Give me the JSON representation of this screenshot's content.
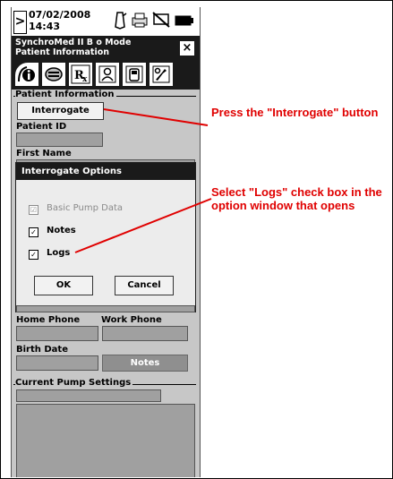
{
  "status_bar": {
    "date": "07/02/2008",
    "time": "14:43",
    "chevron": ">"
  },
  "title_bar": {
    "line1": "SynchroMed II B o Mode",
    "line2": "Patient Information",
    "close": "×"
  },
  "tabs": [
    "info-icon",
    "pump-icon",
    "rx-icon",
    "patient-icon",
    "phone-icon",
    "tools-icon"
  ],
  "patient_info": {
    "group_label": "Patient Information",
    "interrogate_label": "Interrogate",
    "patient_id_label": "Patient ID",
    "first_name_label": "First Name",
    "home_phone_label": "Home Phone",
    "work_phone_label": "Work Phone",
    "birth_date_label": "Birth Date",
    "notes_label": "Notes"
  },
  "dialog": {
    "title": "Interrogate Options",
    "options": [
      {
        "label": "Basic Pump Data",
        "checked": true,
        "enabled": false
      },
      {
        "label": "Notes",
        "checked": true,
        "enabled": true
      },
      {
        "label": "Logs",
        "checked": true,
        "enabled": true
      }
    ],
    "ok_label": "OK",
    "cancel_label": "Cancel"
  },
  "pump_settings": {
    "group_label": "Current Pump Settings"
  },
  "annotations": {
    "interrogate_note": "Press the \"Interrogate\" button",
    "logs_note": "Select \"Logs\" check box in the option window that opens",
    "color": "#e00000"
  }
}
